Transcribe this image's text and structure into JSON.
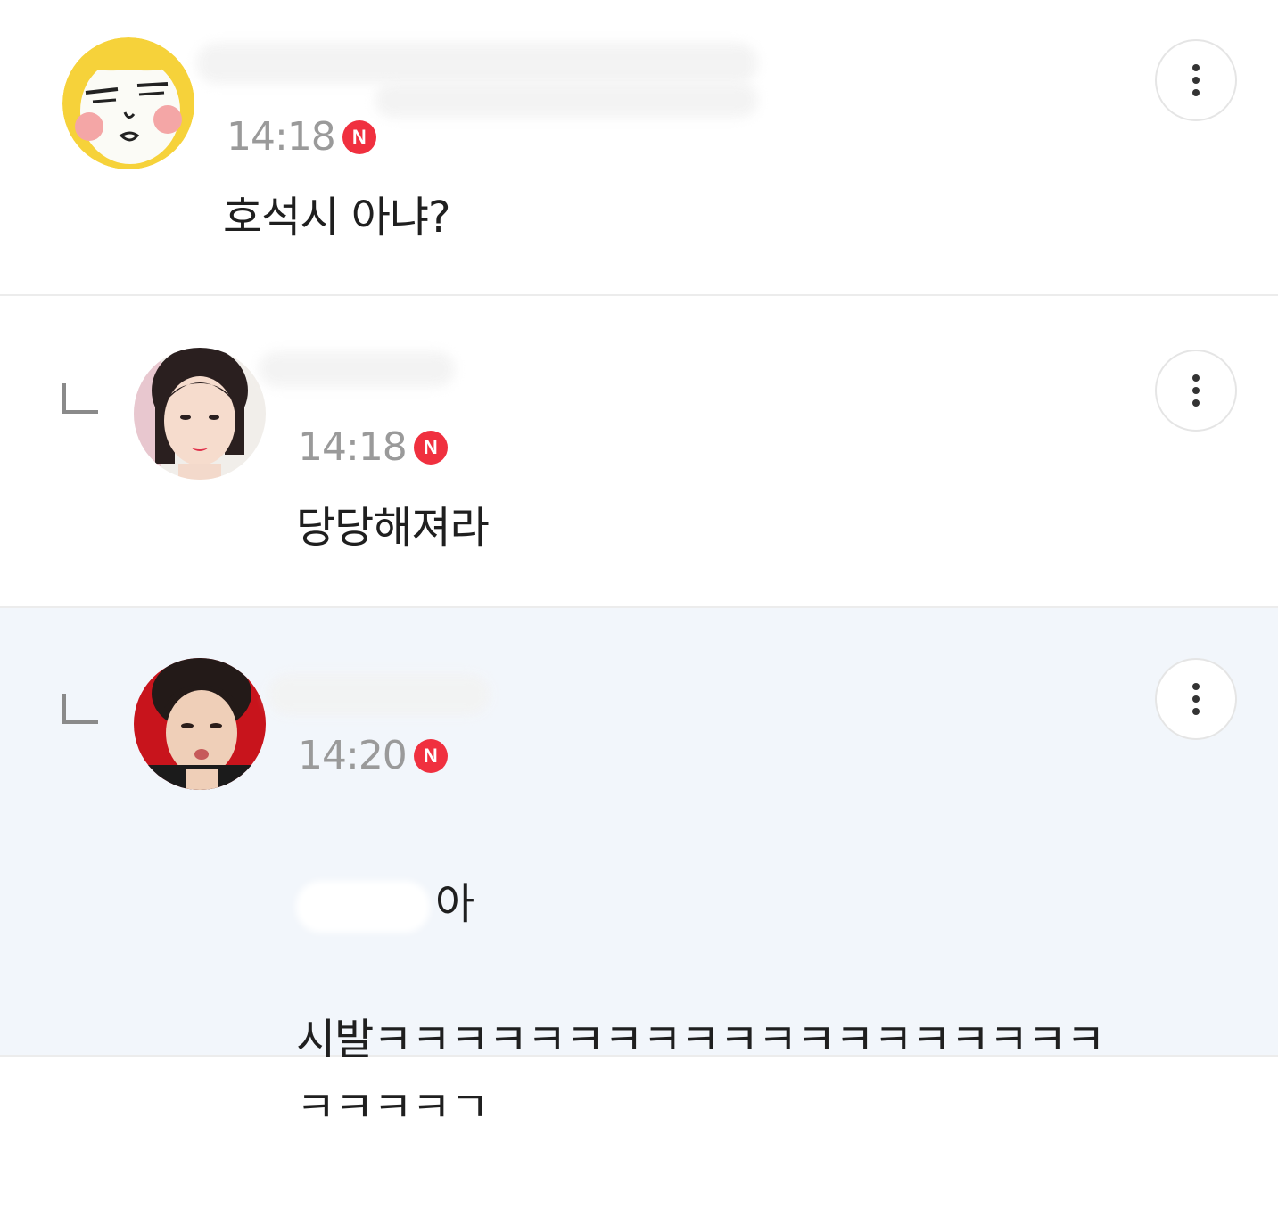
{
  "comments": [
    {
      "time": "14:18",
      "badge": "N",
      "text": "호석시 아냐?",
      "avatar": "cartoon-face-avatar"
    },
    {
      "time": "14:18",
      "badge": "N",
      "text": "당당해져라",
      "avatar": "woman-portrait-avatar"
    },
    {
      "time": "14:20",
      "badge": "N",
      "text_line1": "아",
      "text_line2": "시발ㅋㅋㅋㅋㅋㅋㅋㅋㅋㅋㅋㅋㅋㅋㅋㅋㅋㅋㅋ\nㅋㅋㅋㅋㄱ",
      "avatar": "man-portrait-avatar"
    }
  ],
  "icons": {
    "more": "more-vertical-icon",
    "reply": "reply-arrow-icon",
    "new": "new-badge-icon"
  },
  "colors": {
    "badge": "#f0303f",
    "highlight_row": "#f2f6fb",
    "time": "#9a9a9a"
  }
}
